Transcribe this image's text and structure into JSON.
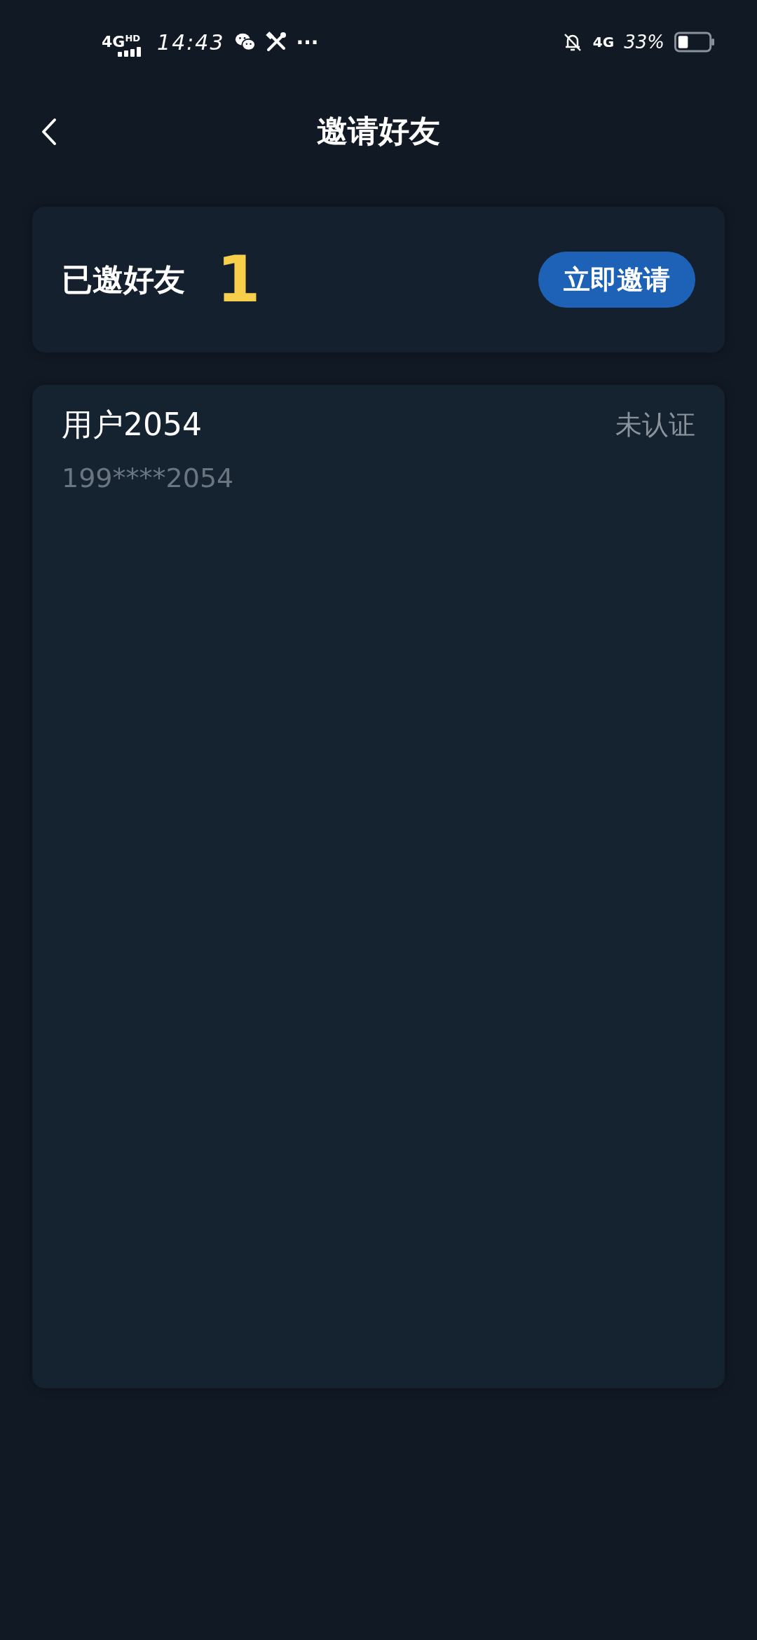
{
  "status_bar": {
    "network_left": "4G$^{HD}$",
    "time": "14:43",
    "more": "···",
    "network_right": "4G",
    "battery": "33%"
  },
  "header": {
    "title": "邀请好友"
  },
  "summary": {
    "label": "已邀好友",
    "count": "1",
    "button": "立即邀请"
  },
  "friends": [
    {
      "name": "用户2054",
      "status": "未认证",
      "phone": "199****2054"
    }
  ]
}
